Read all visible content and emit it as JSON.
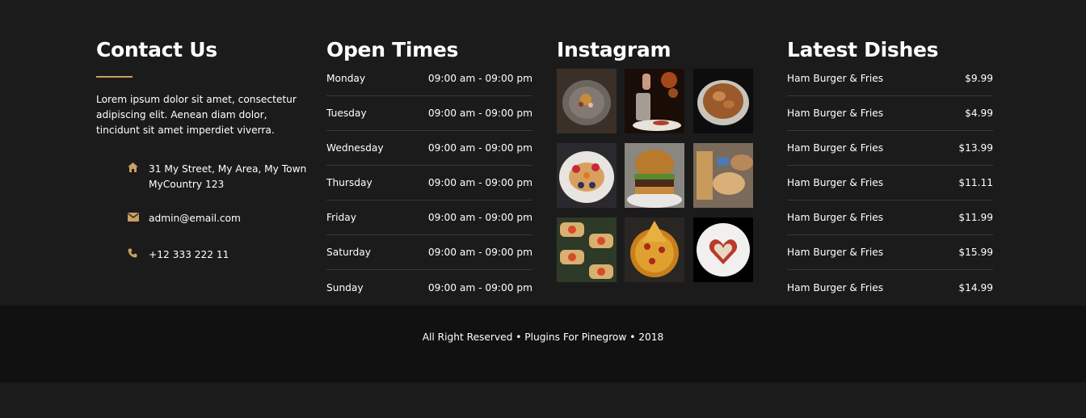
{
  "contact": {
    "title": "Contact Us",
    "about": "Lorem ipsum dolor sit amet, consectetur adipiscing elit. Aenean diam dolor, tincidunt sit amet imperdiet viverra.",
    "address_line1": "31 My Street, My Area, My Town",
    "address_line2": "MyCountry 123",
    "email": "admin@email.com",
    "phone": "+12 333 222 11",
    "accent_color": "#c8a060"
  },
  "open_times": {
    "title": "Open Times",
    "rows": [
      {
        "day": "Monday",
        "hours": "09:00 am - 09:00 pm"
      },
      {
        "day": "Tuesday",
        "hours": "09:00 am - 09:00 pm"
      },
      {
        "day": "Wednesday",
        "hours": "09:00 am - 09:00 pm"
      },
      {
        "day": "Thursday",
        "hours": "09:00 am - 09:00 pm"
      },
      {
        "day": "Friday",
        "hours": "09:00 am - 09:00 pm"
      },
      {
        "day": "Saturday",
        "hours": "09:00 am - 09:00 pm"
      },
      {
        "day": "Sunday",
        "hours": "09:00 am - 09:00 pm"
      }
    ]
  },
  "instagram": {
    "title": "Instagram",
    "photos": [
      "plated-dessert",
      "cocktail-drinks",
      "pie",
      "pancakes-berries",
      "burger",
      "breads",
      "bruschetta",
      "pizza",
      "heart-dessert"
    ]
  },
  "latest_dishes": {
    "title": "Latest Dishes",
    "rows": [
      {
        "name": "Ham Burger & Fries",
        "price": "$9.99"
      },
      {
        "name": "Ham Burger & Fries",
        "price": "$4.99"
      },
      {
        "name": "Ham Burger & Fries",
        "price": "$13.99"
      },
      {
        "name": "Ham Burger & Fries",
        "price": "$11.11"
      },
      {
        "name": "Ham Burger & Fries",
        "price": "$11.99"
      },
      {
        "name": "Ham Burger & Fries",
        "price": "$15.99"
      },
      {
        "name": "Ham Burger & Fries",
        "price": "$14.99"
      }
    ]
  },
  "footer": {
    "copyright": "All Right Reserved • Plugins For Pinegrow • 2018"
  }
}
